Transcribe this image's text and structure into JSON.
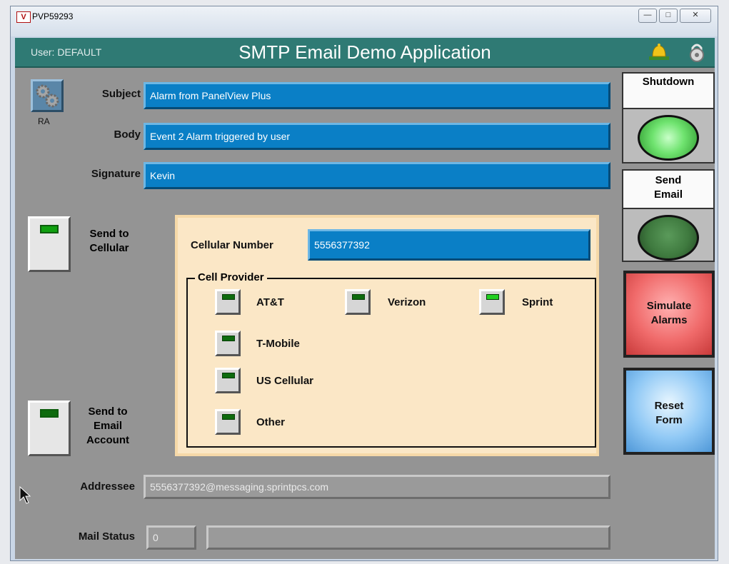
{
  "window": {
    "logo": "V",
    "title": "PVP59293",
    "controls": [
      "—",
      "□",
      "✕"
    ]
  },
  "header": {
    "user": "User: DEFAULT",
    "title": "SMTP Email Demo Application"
  },
  "icons": {
    "gear": "gears-icon",
    "bell": "bell-icon",
    "lock": "lock-icon"
  },
  "ra_label": "RA",
  "form": {
    "subject_label": "Subject",
    "subject_value": "Alarm from PanelView Plus",
    "body_label": "Body",
    "body_value": "Event 2 Alarm triggered by user",
    "signature_label": "Signature",
    "signature_value": "Kevin"
  },
  "send_cellular_label": "Send to\nCellular",
  "send_email_label": "Send to\nEmail\nAccount",
  "cellular": {
    "number_label": "Cellular Number",
    "number_value": "5556377392",
    "provider_legend": "Cell Provider",
    "providers": [
      {
        "label": "AT&T",
        "selected": false
      },
      {
        "label": "Verizon",
        "selected": false
      },
      {
        "label": "Sprint",
        "selected": true
      },
      {
        "label": "T-Mobile",
        "selected": false
      },
      {
        "label": "US Cellular",
        "selected": false
      },
      {
        "label": "Other",
        "selected": false
      }
    ]
  },
  "addressee_label": "Addressee",
  "addressee_value": "5556377392@messaging.sprintpcs.com",
  "mail_status_label": "Mail Status",
  "mail_status_code": "0",
  "mail_status_text": "",
  "side": {
    "shutdown": "Shutdown",
    "send_email": "Send\nEmail",
    "simulate": "Simulate\nAlarms",
    "reset": "Reset\nForm"
  },
  "colors": {
    "header": "#2f7a74",
    "field": "#0a7fc6",
    "panel": "#fbe7c6",
    "lamp_on": "#8ff08f",
    "lamp_off": "#3f7a3f",
    "simulate": "#f06a6a",
    "reset": "#8fc8f5"
  }
}
